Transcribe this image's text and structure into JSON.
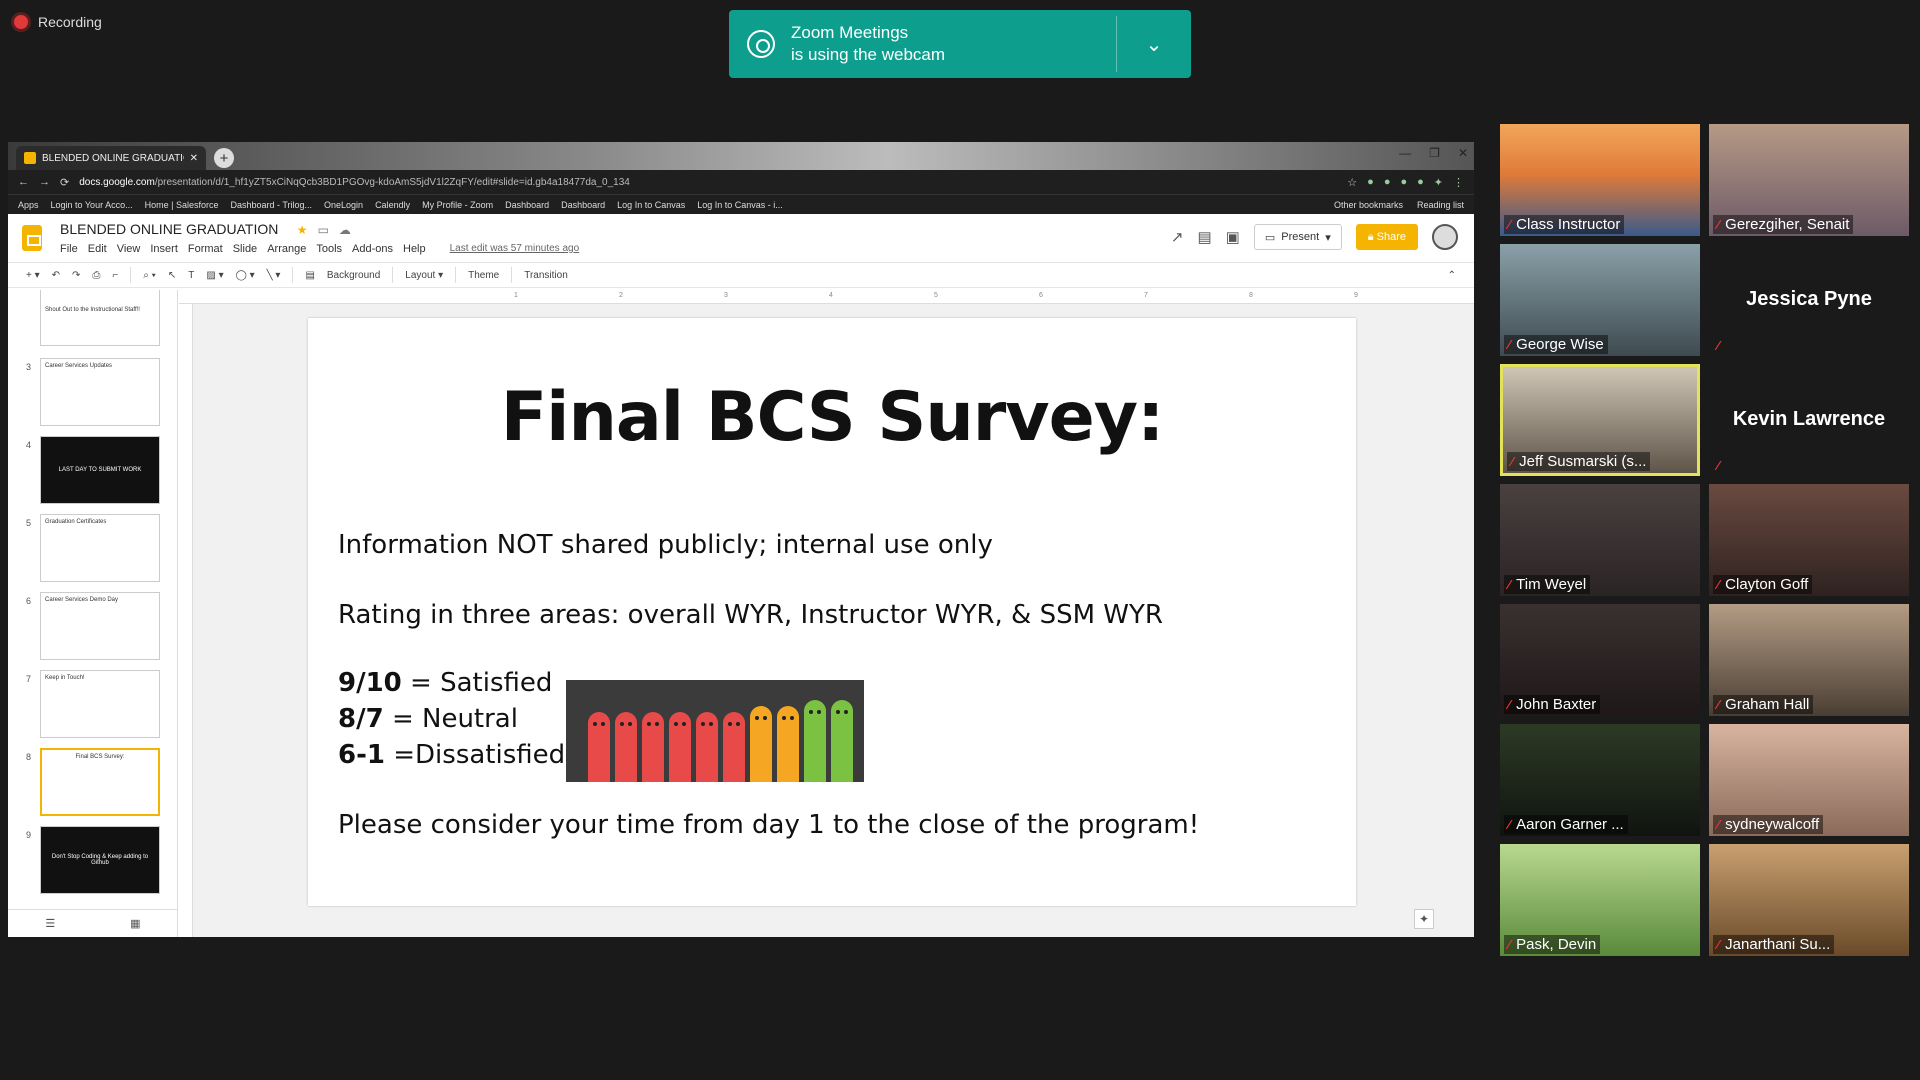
{
  "zoom": {
    "recording_label": "Recording",
    "toast_line1": "Zoom Meetings",
    "toast_line2": "is using the webcam",
    "colors": {
      "toast": "#0e9e8e",
      "active_speaker": "#e3e35a"
    }
  },
  "browser": {
    "tab_title": "BLENDED ONLINE GRADUATION",
    "url_domain": "docs.google.com",
    "url_path": "/presentation/d/1_hf1yZT5xCiNqQcb3BD1PGOvg-kdoAmS5jdV1l2ZqFY/edit#slide=id.gb4a18477da_0_134",
    "bookmarks": [
      "Apps",
      "Login to Your Acco...",
      "Home | Salesforce",
      "Dashboard - Trilog...",
      "OneLogin",
      "Calendly",
      "My Profile - Zoom",
      "Dashboard",
      "Dashboard",
      "Log In to Canvas",
      "Log In to Canvas - i..."
    ],
    "other_bookmarks": "Other bookmarks",
    "reading_list": "Reading list"
  },
  "slides_app": {
    "doc_title": "BLENDED ONLINE GRADUATION",
    "menu": [
      "File",
      "Edit",
      "View",
      "Insert",
      "Format",
      "Slide",
      "Arrange",
      "Tools",
      "Add-ons",
      "Help"
    ],
    "last_edit": "Last edit was 57 minutes ago",
    "present_label": "Present",
    "share_label": "Share",
    "toolbar": {
      "background": "Background",
      "layout": "Layout",
      "theme": "Theme",
      "transition": "Transition"
    },
    "ruler_ticks": [
      "1",
      "2",
      "3",
      "4",
      "5",
      "6",
      "7",
      "8",
      "9"
    ]
  },
  "thumbnails": [
    {
      "num": "",
      "text": "Shout Out to the Instructional Staff!!"
    },
    {
      "num": "3",
      "text": "Career Services Updates"
    },
    {
      "num": "4",
      "text": "LAST DAY TO SUBMIT WORK"
    },
    {
      "num": "5",
      "text": "Graduation Certificates"
    },
    {
      "num": "6",
      "text": "Career Services Demo Day"
    },
    {
      "num": "7",
      "text": "Keep in Touch!"
    },
    {
      "num": "8",
      "text": "Final BCS Survey:"
    },
    {
      "num": "9",
      "text": "Don't Stop Coding & Keep adding to Github"
    }
  ],
  "slide": {
    "title": "Final BCS Survey:",
    "line1": "Information NOT shared publicly; internal use only",
    "line2": "Rating in three areas: overall WYR, Instructor WYR, & SSM WYR",
    "ratings": [
      {
        "score": "9/10",
        "label": " = Satisfied"
      },
      {
        "score": "8/7",
        "label": " = Neutral"
      },
      {
        "score": "6-1",
        "label": " =Dissatisfied"
      }
    ],
    "line_final": "Please consider your time from day 1 to the close of the program!",
    "rating_colors": [
      "#e84a4a",
      "#e84a4a",
      "#e84a4a",
      "#e84a4a",
      "#e84a4a",
      "#e84a4a",
      "#f5a623",
      "#f5a623",
      "#7cc242",
      "#7cc242"
    ]
  },
  "participants": [
    {
      "name": "Class Instructor",
      "type": "video",
      "bg": "linear-gradient(180deg,#f2a65a 0%,#e07a3a 45%,#3a5a8a 100%)"
    },
    {
      "name": "Gerezgiher, Senait",
      "type": "video",
      "bg": "linear-gradient(180deg,#b79a86,#6c5a66)"
    },
    {
      "name": "George Wise",
      "type": "video",
      "bg": "linear-gradient(180deg,#8aa0a8,#3e4a50)"
    },
    {
      "name": "Jessica Pyne",
      "type": "name"
    },
    {
      "name": "Jeff Susmarski (s...",
      "type": "video",
      "bg": "linear-gradient(180deg,#cfc6b6,#5e5448)",
      "active": true
    },
    {
      "name": "Kevin Lawrence",
      "type": "name"
    },
    {
      "name": "Tim Weyel",
      "type": "video",
      "bg": "linear-gradient(180deg,#4a4040,#2a2424)"
    },
    {
      "name": "Clayton Goff",
      "type": "video",
      "bg": "linear-gradient(180deg,#6a4a40,#2e2220)"
    },
    {
      "name": "John Baxter",
      "type": "video",
      "bg": "linear-gradient(180deg,#3a3030,#1e1818)"
    },
    {
      "name": "Graham Hall",
      "type": "video",
      "bg": "linear-gradient(180deg,#b49c84,#4a3e34)"
    },
    {
      "name": "Aaron Garner ...",
      "type": "video",
      "bg": "linear-gradient(180deg,#2c3a24,#101410)"
    },
    {
      "name": "sydneywalcoff",
      "type": "video",
      "bg": "linear-gradient(180deg,#d8b4a0,#8a6a5a)"
    },
    {
      "name": "Pask, Devin",
      "type": "video",
      "bg": "linear-gradient(180deg,#b8d890,#5a8a3a)"
    },
    {
      "name": "Janarthani Su...",
      "type": "video",
      "bg": "linear-gradient(180deg,#c8a070,#6a4a2a)"
    }
  ]
}
